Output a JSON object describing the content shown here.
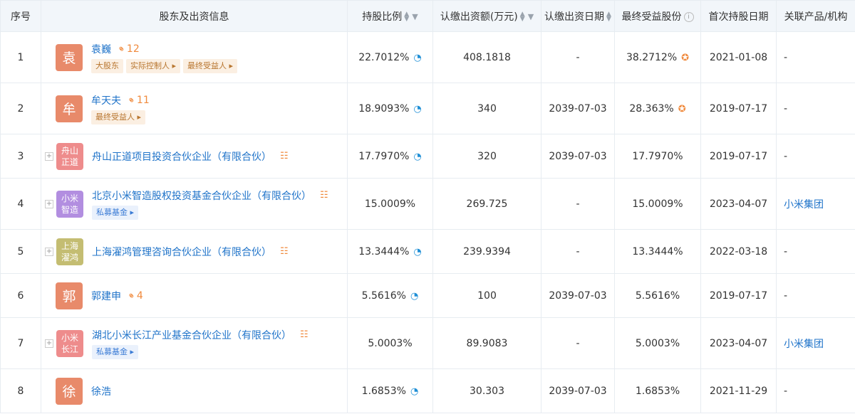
{
  "header": {
    "seq": "序号",
    "holder": "股东及出资信息",
    "ratio": "持股比例",
    "amount": "认缴出资额(万元)",
    "date": "认缴出资日期",
    "beneficial": "最终受益股份",
    "first_date": "首次持股日期",
    "related": "关联产品/机构"
  },
  "icons": {
    "sort": "sort-icon",
    "filter": "filter-icon",
    "info": "info-icon",
    "pie": "pie-chart-icon",
    "beneficiary": "beneficiary-icon",
    "relation": "relation-network-icon",
    "tree": "equity-tree-icon"
  },
  "colors": {
    "link": "#1f73c9",
    "accent": "#f08a3d",
    "avatar_person": "#e88a6a",
    "avatar_pink": "#ee8c8c",
    "avatar_purple": "#b28ee0",
    "avatar_olive": "#c4bd72"
  },
  "rows": [
    {
      "seq": "1",
      "avatar": "袁",
      "name": "袁巍",
      "relation_count": "12",
      "tags": [
        "大股东",
        "实际控制人 ▸",
        "最终受益人 ▸"
      ],
      "ratio": "22.7012%",
      "amount": "408.1818",
      "date": "-",
      "beneficial": "38.2712%",
      "first_date": "2021-01-08",
      "related": "-"
    },
    {
      "seq": "2",
      "avatar": "牟",
      "name": "牟天夫",
      "relation_count": "11",
      "tags": [
        "最终受益人 ▸"
      ],
      "ratio": "18.9093%",
      "amount": "340",
      "date": "2039-07-03",
      "beneficial": "28.363%",
      "first_date": "2019-07-17",
      "related": "-"
    },
    {
      "seq": "3",
      "avatar": "舟山正道",
      "name": "舟山正道项目投资合伙企业（有限合伙）",
      "ratio": "17.7970%",
      "amount": "320",
      "date": "2039-07-03",
      "beneficial": "17.7970%",
      "first_date": "2019-07-17",
      "related": "-"
    },
    {
      "seq": "4",
      "avatar": "小米智造",
      "name": "北京小米智造股权投资基金合伙企业（有限合伙）",
      "tags": [
        "私募基金 ▸"
      ],
      "ratio": "15.0009%",
      "amount": "269.725",
      "date": "-",
      "beneficial": "15.0009%",
      "first_date": "2023-04-07",
      "related": "小米集团"
    },
    {
      "seq": "5",
      "avatar": "上海濯鸿",
      "name": "上海濯鸿管理咨询合伙企业（有限合伙）",
      "ratio": "13.3444%",
      "amount": "239.9394",
      "date": "-",
      "beneficial": "13.3444%",
      "first_date": "2022-03-18",
      "related": "-"
    },
    {
      "seq": "6",
      "avatar": "郭",
      "name": "郭建申",
      "relation_count": "4",
      "ratio": "5.5616%",
      "amount": "100",
      "date": "2039-07-03",
      "beneficial": "5.5616%",
      "first_date": "2019-07-17",
      "related": "-"
    },
    {
      "seq": "7",
      "avatar": "小米长江",
      "name": "湖北小米长江产业基金合伙企业（有限合伙）",
      "tags": [
        "私募基金 ▸"
      ],
      "ratio": "5.0003%",
      "amount": "89.9083",
      "date": "-",
      "beneficial": "5.0003%",
      "first_date": "2023-04-07",
      "related": "小米集团"
    },
    {
      "seq": "8",
      "avatar": "徐",
      "name": "徐浩",
      "ratio": "1.6853%",
      "amount": "30.303",
      "date": "2039-07-03",
      "beneficial": "1.6853%",
      "first_date": "2021-11-29",
      "related": "-"
    }
  ]
}
